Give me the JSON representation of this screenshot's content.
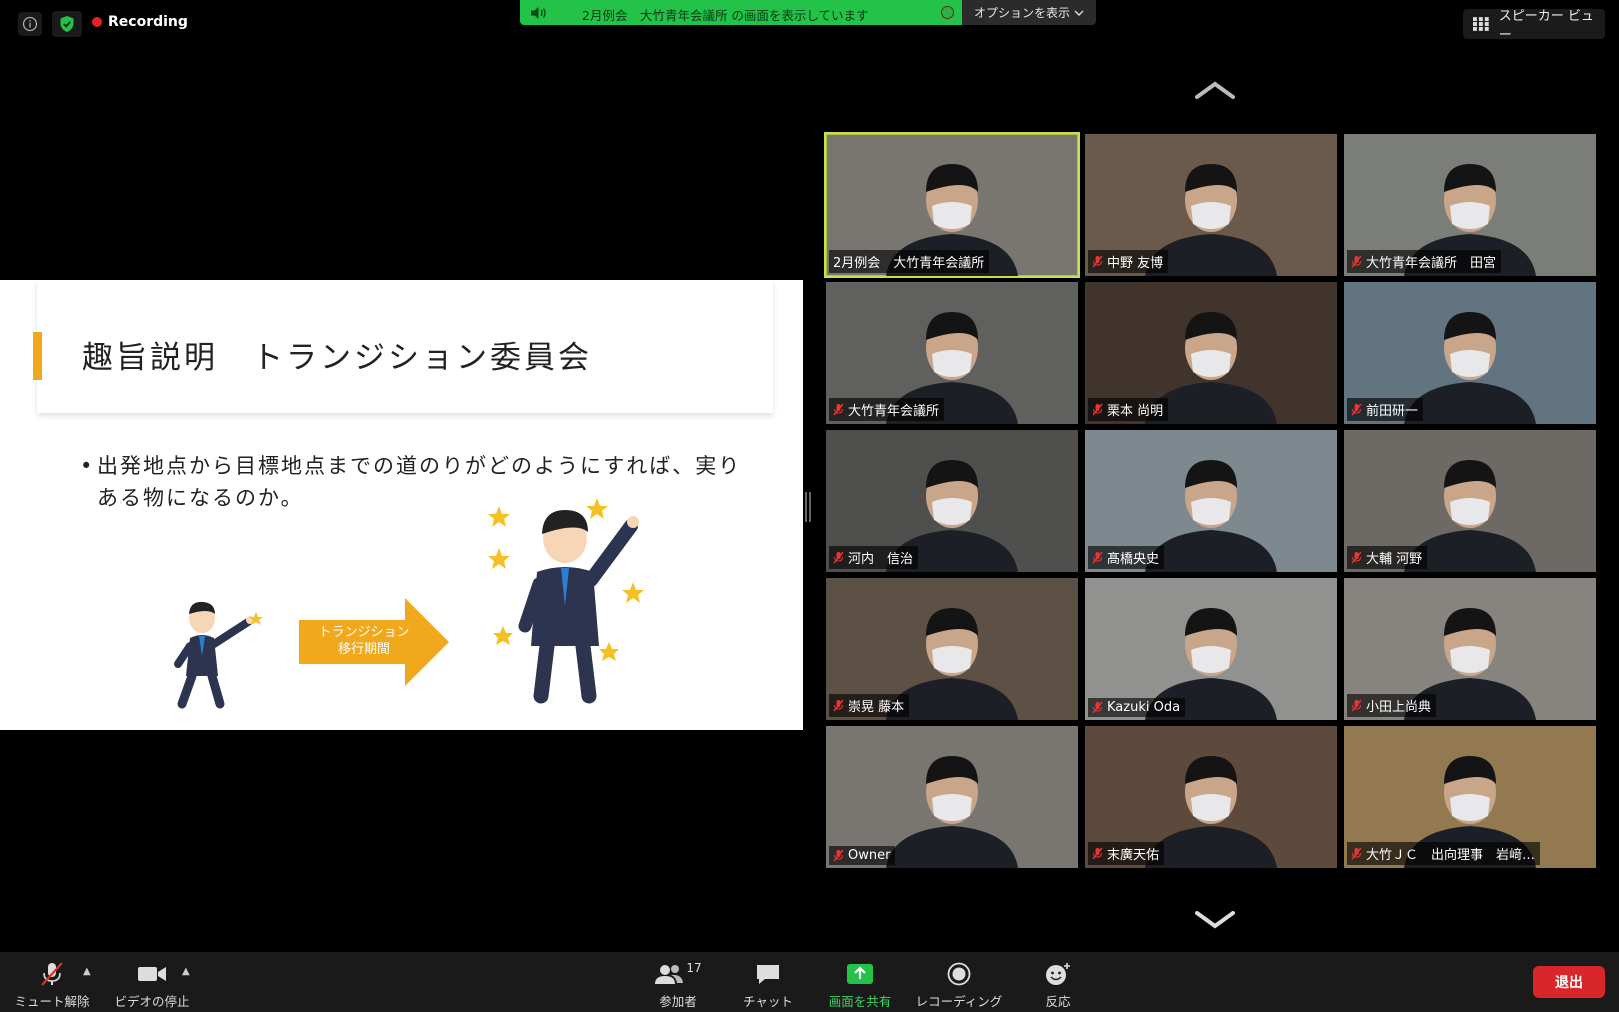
{
  "top": {
    "recording_label": "Recording",
    "share_banner": "2月例会　大竹青年会議所 の画面を表示しています",
    "options_label": "オプションを表示",
    "speaker_view_label": "スピーカー ビュー"
  },
  "slide": {
    "title": "趣旨説明　トランジション委員会",
    "bullet": "出発地点から目標地点までの道のりがどのようにすれば、実りある物になるのか。",
    "arrow_line1": "トランジション",
    "arrow_line2": "移行期間"
  },
  "participants": [
    {
      "name": "2月例会　大竹青年会議所",
      "muted": false,
      "active": true,
      "bg": "#8a8782"
    },
    {
      "name": "中野 友博",
      "muted": true,
      "bg": "#7a6656"
    },
    {
      "name": "大竹青年会議所　田宮",
      "muted": true,
      "bg": "#8c8f8a"
    },
    {
      "name": "大竹青年会議所",
      "muted": true,
      "bg": "#6e6f6c"
    },
    {
      "name": "栗本 尚明",
      "muted": true,
      "bg": "#4a3c34"
    },
    {
      "name": "前田研一",
      "muted": true,
      "bg": "#6f8592"
    },
    {
      "name": "河内　信治",
      "muted": true,
      "bg": "#5a5a58"
    },
    {
      "name": "髙橋央史",
      "muted": true,
      "bg": "#8f9ba3"
    },
    {
      "name": "大輔 河野",
      "muted": true,
      "bg": "#7d7873"
    },
    {
      "name": "崇晃 藤本",
      "muted": true,
      "bg": "#6a5c4f"
    },
    {
      "name": "Kazuki Oda",
      "muted": true,
      "bg": "#a5a6a4"
    },
    {
      "name": "小田上尚典",
      "muted": true,
      "bg": "#9a9690"
    },
    {
      "name": "Owner",
      "muted": true,
      "bg": "#8a8680"
    },
    {
      "name": "末廣天佑",
      "muted": true,
      "bg": "#6b5545"
    },
    {
      "name": "大竹ＪＣ　出向理事　岩﨑…",
      "muted": true,
      "bg": "#a88a5a"
    }
  ],
  "toolbar": {
    "unmute": "ミュート解除",
    "stop_video": "ビデオの停止",
    "participants": "参加者",
    "participant_count": "17",
    "chat": "チャット",
    "share_screen": "画面を共有",
    "record": "レコーディング",
    "reactions": "反応",
    "leave": "退出"
  },
  "colors": {
    "accent_green": "#23c34a",
    "active_outline": "#c8e04a",
    "leave_red": "#d9262b",
    "slide_accent": "#f0a81c"
  }
}
